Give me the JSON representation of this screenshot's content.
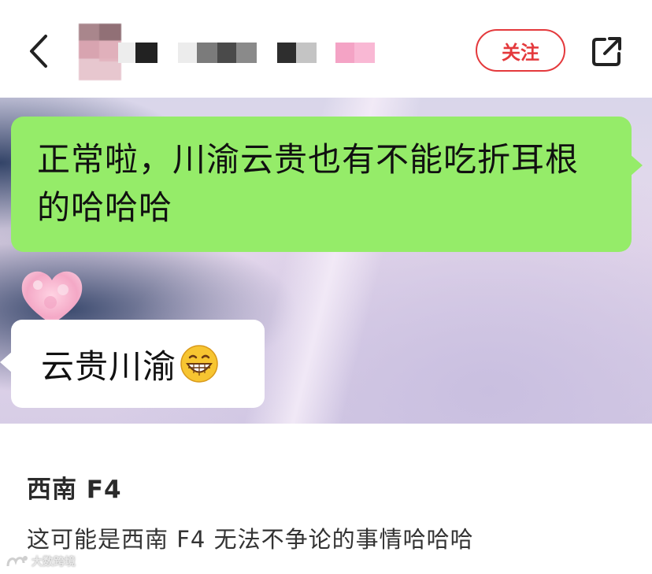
{
  "header": {
    "follow_label": "关注"
  },
  "chat": {
    "message_1": "正常啦，川渝云贵也有不能吃折耳根的哈哈哈",
    "message_2": "云贵川渝",
    "message_2_emoji": "grinning-face-icon"
  },
  "post": {
    "title": "西南 F4",
    "body": "这可能是西南 F4 无法不争论的事情哈哈哈"
  },
  "watermark": {
    "text": "大数跨境"
  },
  "colors": {
    "accent": "#e4393c",
    "sent_bubble": "#95ec69",
    "received_bubble": "#ffffff"
  },
  "icons": [
    "back-arrow-icon",
    "share-icon",
    "heart-avatar-icon",
    "grinning-face-icon"
  ]
}
